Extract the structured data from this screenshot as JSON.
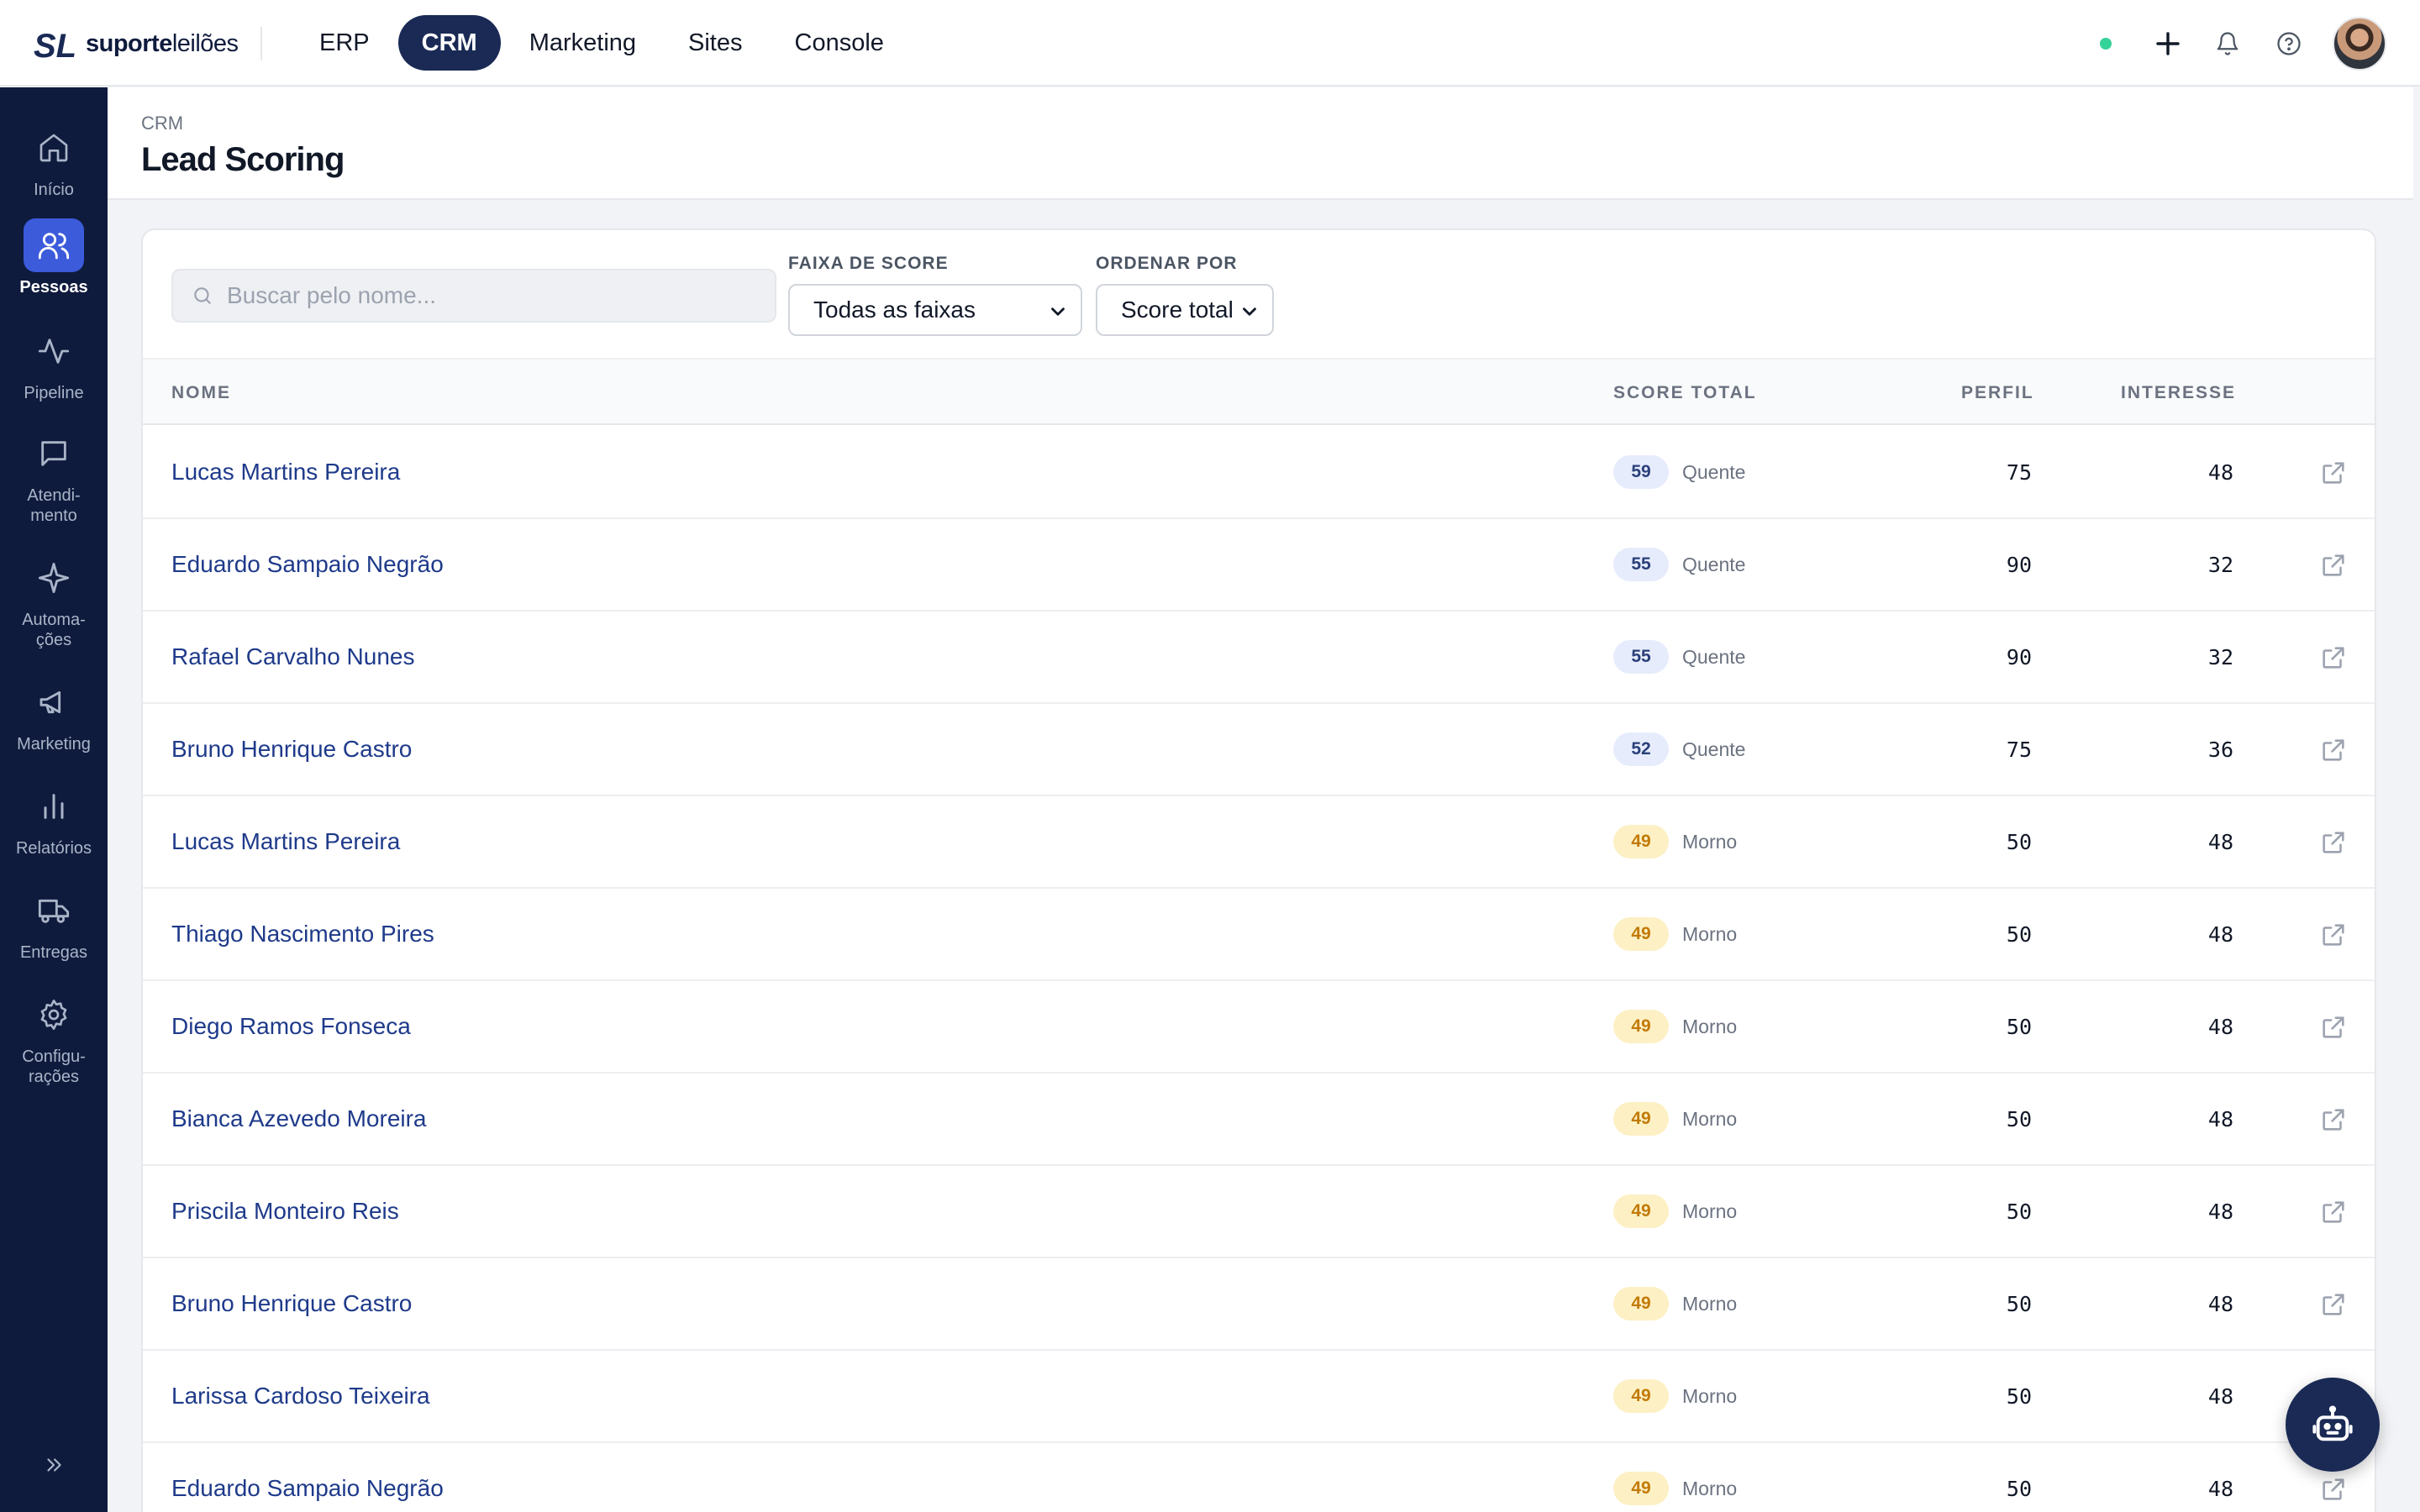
{
  "brand": {
    "name_bold": "suporte",
    "name_light": "leilões",
    "mark": "SL"
  },
  "nav": {
    "items": [
      {
        "label": "ERP",
        "active": false
      },
      {
        "label": "CRM",
        "active": true
      },
      {
        "label": "Marketing",
        "active": false
      },
      {
        "label": "Sites",
        "active": false
      },
      {
        "label": "Console",
        "active": false
      }
    ]
  },
  "topbar_icons": [
    "status-online-dot",
    "plus-icon",
    "bell-icon",
    "help-icon",
    "user-avatar"
  ],
  "sidebar": {
    "items": [
      {
        "label": "Início",
        "icon": "home-icon",
        "active": false
      },
      {
        "label": "Pessoas",
        "icon": "users-icon",
        "active": true
      },
      {
        "label": "Pipeline",
        "icon": "activity-icon",
        "active": false
      },
      {
        "label": "Atendi-\nmento",
        "icon": "message-icon",
        "active": false
      },
      {
        "label": "Automa-\nções",
        "icon": "sparkle-icon",
        "active": false
      },
      {
        "label": "Marketing",
        "icon": "megaphone-icon",
        "active": false
      },
      {
        "label": "Relatórios",
        "icon": "bar-chart-icon",
        "active": false
      },
      {
        "label": "Entregas",
        "icon": "truck-icon",
        "active": false
      },
      {
        "label": "Configu-\nrações",
        "icon": "gear-icon",
        "active": false
      }
    ],
    "expand_icon": "chevrons-right-icon"
  },
  "page": {
    "breadcrumb": "CRM",
    "title": "Lead Scoring"
  },
  "filters": {
    "search_placeholder": "Buscar pelo nome...",
    "score_range_label": "FAIXA DE SCORE",
    "score_range_value": "Todas as faixas",
    "order_label": "ORDENAR POR",
    "order_value": "Score total"
  },
  "table": {
    "columns": {
      "name": "NOME",
      "score": "SCORE TOTAL",
      "profile": "PERFIL",
      "interest": "INTERESSE"
    },
    "rows": [
      {
        "name": "Lucas Martins Pereira",
        "score": "59",
        "tier": "Quente",
        "profile": "75",
        "interest": "48"
      },
      {
        "name": "Eduardo Sampaio Negrão",
        "score": "55",
        "tier": "Quente",
        "profile": "90",
        "interest": "32"
      },
      {
        "name": "Rafael Carvalho Nunes",
        "score": "55",
        "tier": "Quente",
        "profile": "90",
        "interest": "32"
      },
      {
        "name": "Bruno Henrique Castro",
        "score": "52",
        "tier": "Quente",
        "profile": "75",
        "interest": "36"
      },
      {
        "name": "Lucas Martins Pereira",
        "score": "49",
        "tier": "Morno",
        "profile": "50",
        "interest": "48"
      },
      {
        "name": "Thiago Nascimento Pires",
        "score": "49",
        "tier": "Morno",
        "profile": "50",
        "interest": "48"
      },
      {
        "name": "Diego Ramos Fonseca",
        "score": "49",
        "tier": "Morno",
        "profile": "50",
        "interest": "48"
      },
      {
        "name": "Bianca Azevedo Moreira",
        "score": "49",
        "tier": "Morno",
        "profile": "50",
        "interest": "48"
      },
      {
        "name": "Priscila Monteiro Reis",
        "score": "49",
        "tier": "Morno",
        "profile": "50",
        "interest": "48"
      },
      {
        "name": "Bruno Henrique Castro",
        "score": "49",
        "tier": "Morno",
        "profile": "50",
        "interest": "48"
      },
      {
        "name": "Larissa Cardoso Teixeira",
        "score": "49",
        "tier": "Morno",
        "profile": "50",
        "interest": "48"
      },
      {
        "name": "Eduardo Sampaio Negrão",
        "score": "49",
        "tier": "Morno",
        "profile": "50",
        "interest": "48"
      }
    ]
  },
  "colors": {
    "sidebar_bg": "#0f1b3d",
    "accent": "#3b5bdb",
    "link": "#1e3a8a",
    "hot_pill": "#e6ecfb",
    "warm_pill": "#fdf0c4"
  },
  "assistant_icon": "robot-icon"
}
